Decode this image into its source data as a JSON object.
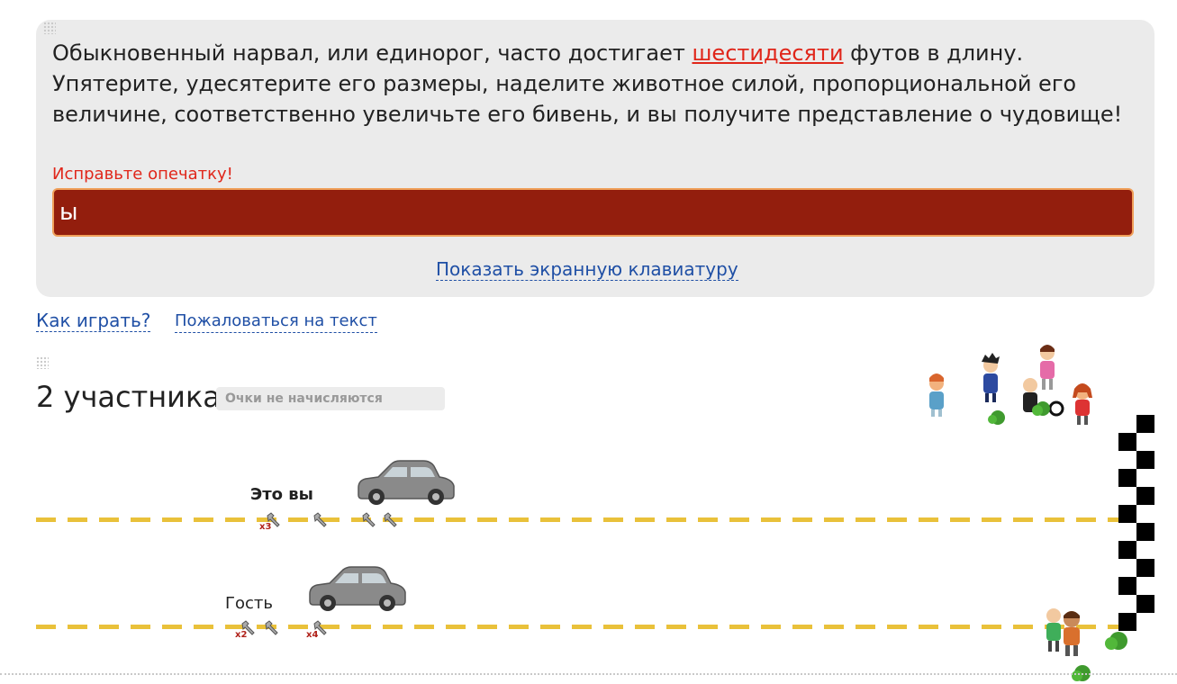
{
  "quote": {
    "before": "Обыкновенный нарвал, или единорог, часто достигает ",
    "highlight": "шестидесяти",
    "after": " футов в длину. Упятерите, удесятерите его размеры, наделите животное силой, пропорциональной его величине, соответственно увеличьте его бивень, и вы получите представление о чудовище!"
  },
  "typo_message": "Исправьте опечатку!",
  "input_value": "ы",
  "show_keyboard": "Показать экранную клавиатуру",
  "links": {
    "how_to_play": "Как играть?",
    "report_text": "Пожаловаться на текст"
  },
  "race": {
    "title": "2 участника",
    "scoring_badge": "Очки не начисляются",
    "players": [
      {
        "name": "Это вы",
        "bold": true,
        "multipliers": [
          "x3"
        ]
      },
      {
        "name": "Гость",
        "bold": false,
        "multipliers": [
          "x2",
          "x4"
        ]
      }
    ]
  },
  "colors": {
    "accent_red": "#e0261a",
    "input_bg": "#931e0d",
    "link_blue": "#1f4fa5",
    "lane_yellow": "#e9c13a"
  },
  "icons": [
    "wrench-icon",
    "car-icon",
    "spectator-icon",
    "bush-icon",
    "finish-flag-icon"
  ]
}
